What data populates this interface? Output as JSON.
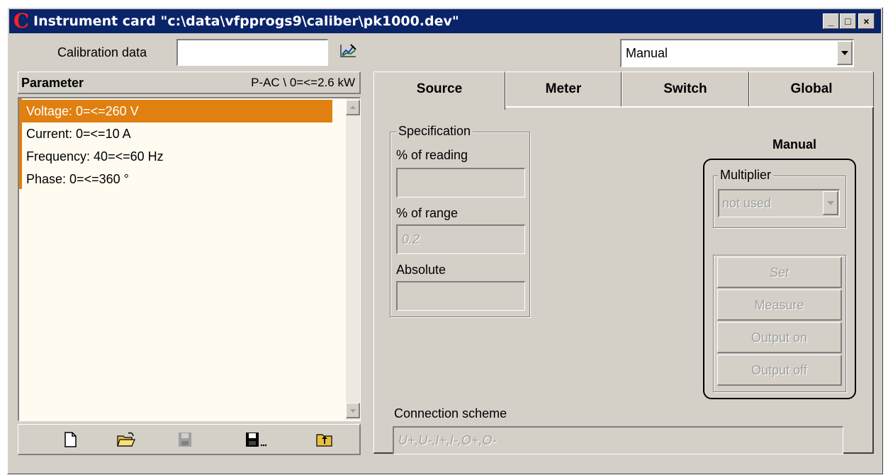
{
  "window": {
    "logo": "C",
    "title": "Instrument card \"c:\\data\\vfpprogs9\\caliber\\pk1000.dev\"",
    "minimize_label": "_",
    "maximize_label": "□",
    "close_label": "×"
  },
  "calibration": {
    "label": "Calibration data",
    "value": ""
  },
  "mode_select": {
    "value": "Manual"
  },
  "parameter_panel": {
    "header": "Parameter",
    "subheader": "P-AC \\ 0=<=2.6 kW",
    "items": [
      "Voltage: 0=<=260 V",
      "Current: 0=<=10 A",
      "Frequency: 40=<=60 Hz",
      "Phase: 0=<=360 °"
    ],
    "selected_index": 0
  },
  "tabs": [
    "Source",
    "Meter",
    "Switch",
    "Global"
  ],
  "active_tab": "Source",
  "specification": {
    "legend": "Specification",
    "reading_label": "% of reading",
    "reading_value": "",
    "range_label": "% of range",
    "range_value": "0.2",
    "absolute_label": "Absolute",
    "absolute_value": ""
  },
  "manual_panel": {
    "title": "Manual",
    "multiplier_legend": "Multiplier",
    "multiplier_value": "not used",
    "buttons": [
      "Set",
      "Measure",
      "Output on",
      "Output off"
    ]
  },
  "connection": {
    "label": "Connection scheme",
    "value": "U+,U-,I+,I-,O+,O-"
  }
}
